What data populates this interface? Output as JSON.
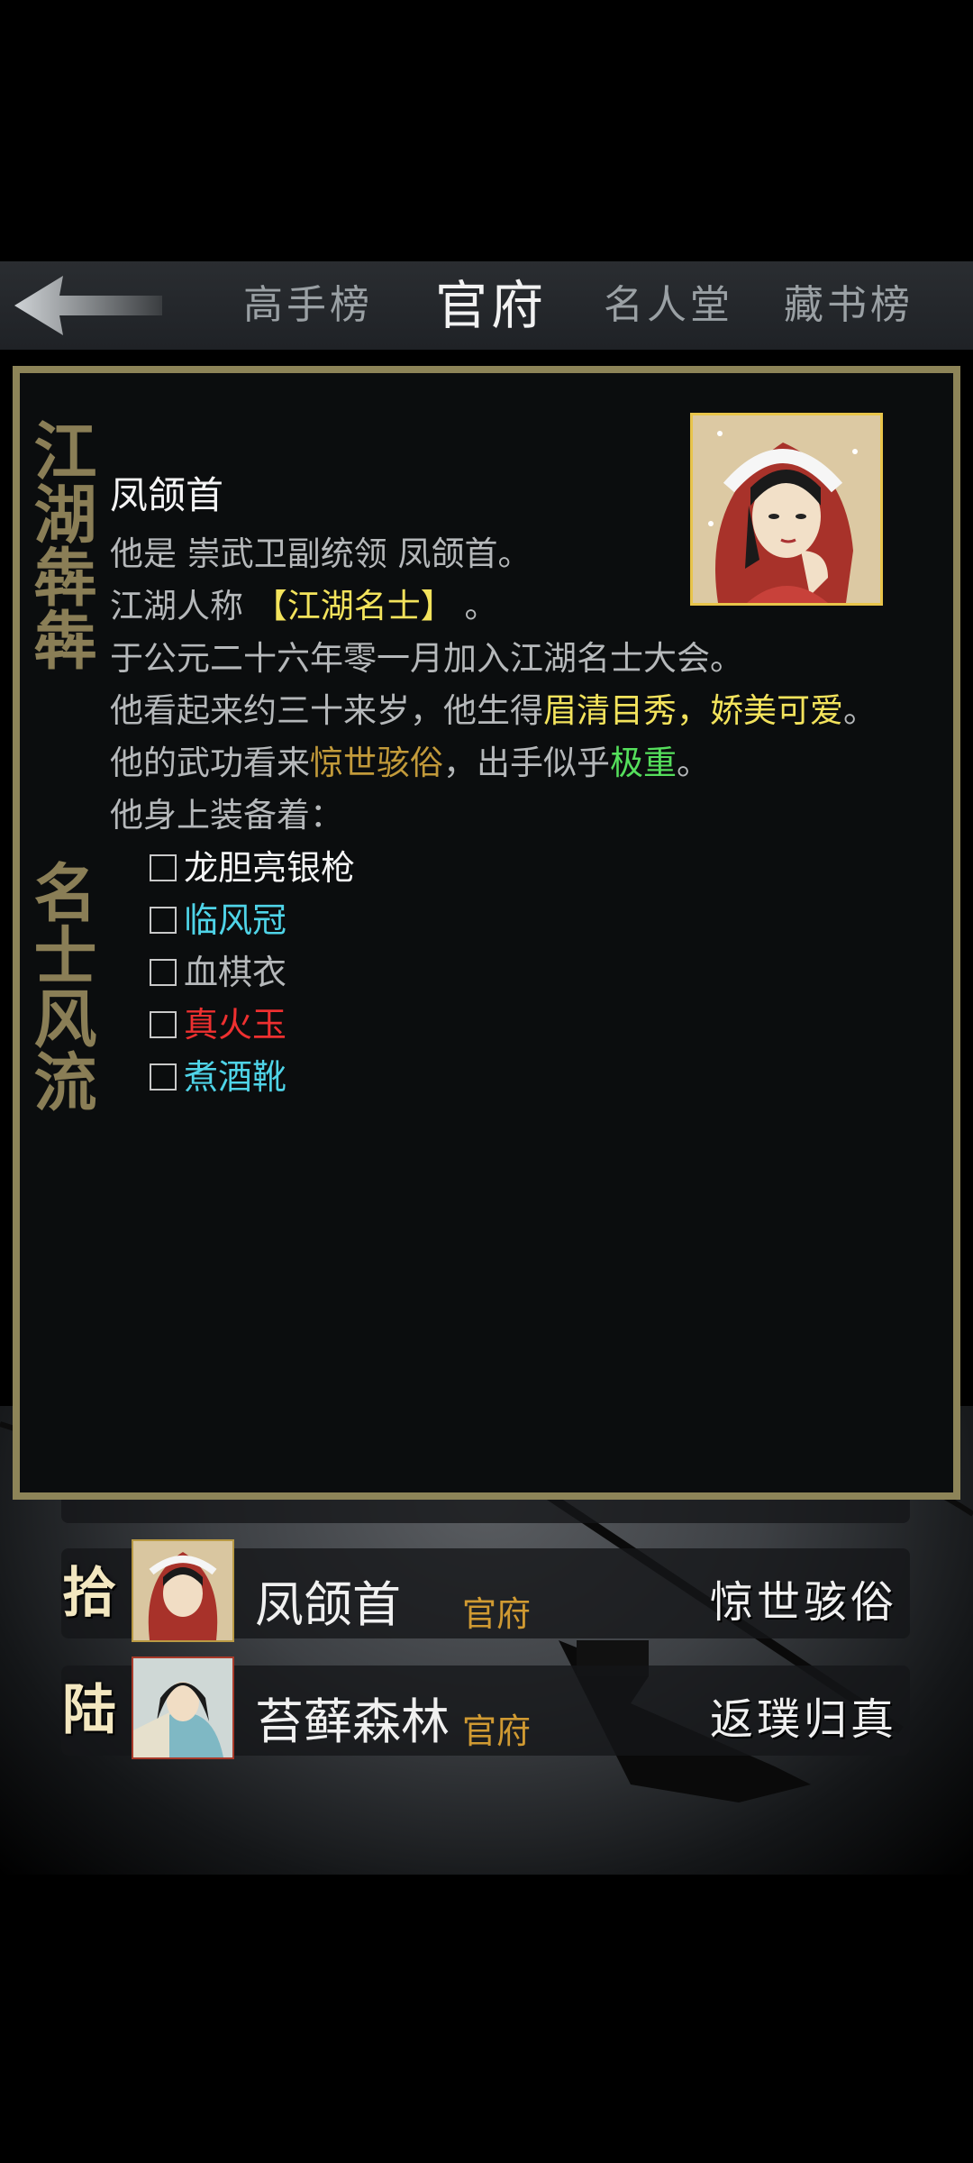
{
  "nav": {
    "tabs": [
      {
        "label": "高手榜"
      },
      {
        "label": "官府"
      },
      {
        "label": "名人堂"
      },
      {
        "label": "藏书榜"
      }
    ]
  },
  "colors": {
    "accent_gold": "#8d8458",
    "highlight_yellow": "#f3e35c",
    "highlight_gold": "#c29a3a",
    "highlight_green": "#55df5c",
    "cyan_item": "#4fd4e8",
    "red_item": "#ee3030"
  },
  "detail": {
    "seal_top": "江湖犇犇",
    "seal_bottom": "名士风流",
    "name": "凤颌首",
    "line1_a": "他是 崇武卫副统领 凤颌首。",
    "line2_a": "江湖人称 ",
    "line2_title": "【江湖名士】",
    "line2_b": " 。",
    "line3": "于公元二十六年零一月加入江湖名士大会。",
    "line4_a": "他看起来约三十来岁，他生得",
    "line4_hl": "眉清目秀，娇美可爱",
    "line4_b": "。",
    "line5_a": "他的武功看来",
    "line5_hl1": "惊世骇俗",
    "line5_b": "，出手似乎",
    "line5_hl2": "极重",
    "line5_c": "。",
    "line6": "他身上装备着：",
    "equipment": [
      {
        "name": "龙胆亮银枪",
        "color": "#f4f4f4"
      },
      {
        "name": "临风冠",
        "color": "#4fd4e8"
      },
      {
        "name": "血棋衣",
        "color": "#b5b8ba"
      },
      {
        "name": "真火玉",
        "color": "#ee3030"
      },
      {
        "name": "煮酒靴",
        "color": "#4fd4e8"
      }
    ]
  },
  "list": {
    "rows": [
      {
        "rank": "拾",
        "name": "凤颌首",
        "org": "官府",
        "level": "惊世骇俗"
      },
      {
        "rank": "陆",
        "name": "苔藓森林",
        "org": "官府",
        "level": "返璞归真"
      }
    ]
  }
}
